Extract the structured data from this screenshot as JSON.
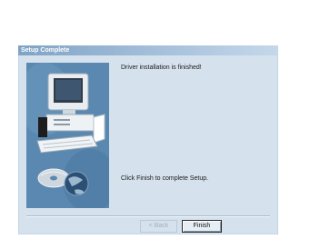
{
  "window": {
    "title": "Setup Complete"
  },
  "content": {
    "message_top": "Driver installation is finished!",
    "message_bottom": "Click Finish to complete Setup."
  },
  "buttons": {
    "back_label": "< Back",
    "finish_label": "Finish"
  },
  "illustration": {
    "icon": "computer-with-cd-and-globe-icon"
  },
  "colors": {
    "title_bar": "#7fa3c5",
    "window_bg": "#d5e2ed",
    "art_panel": "#5a88b0"
  }
}
